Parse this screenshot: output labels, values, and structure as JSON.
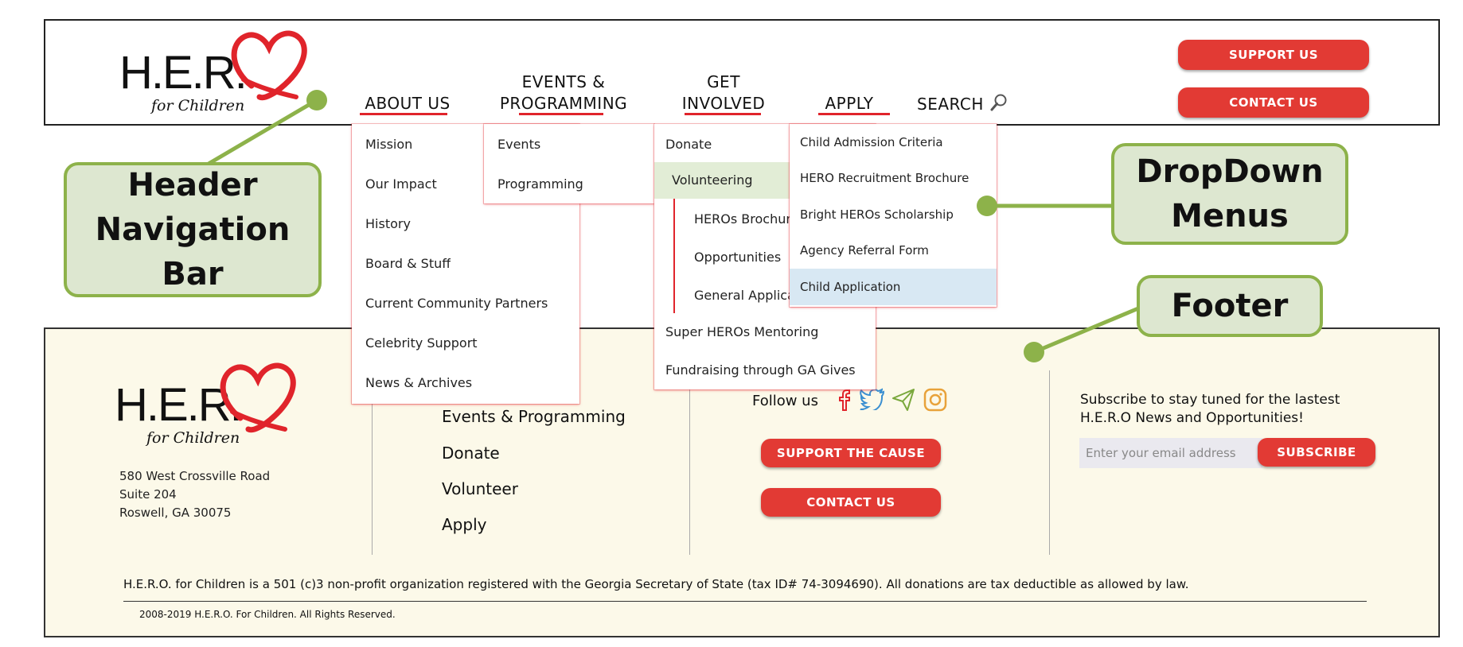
{
  "header": {
    "logo": {
      "letters": "H.E.R.",
      "tagline": "for Children"
    },
    "nav": [
      {
        "line1": "",
        "line2": "ABOUT US"
      },
      {
        "line1": "EVENTS &",
        "line2": "PROGRAMMING"
      },
      {
        "line1": "GET",
        "line2": "INVOLVED"
      },
      {
        "line1": "",
        "line2": "APPLY"
      }
    ],
    "search_label": "SEARCH",
    "support_button": "SUPPORT US",
    "contact_button": "CONTACT US"
  },
  "dropdowns": {
    "about": [
      "Mission",
      "Our Impact",
      "History",
      "Board & Stuff",
      "Current Community Partners",
      "Celebrity Support",
      "News & Archives"
    ],
    "events": [
      "Events",
      "Programming"
    ],
    "involved": {
      "donate": "Donate",
      "volunteering": "Volunteering",
      "volunteering_sub": [
        "HEROs Brochure",
        "Opportunities",
        "General Application"
      ],
      "mentoring": "Super HEROs Mentoring",
      "fundraising": "Fundraising through GA Gives"
    },
    "apply": [
      "Child Admission Criteria",
      "HERO Recruitment Brochure",
      "Bright HEROs Scholarship",
      "Agency Referral Form",
      "Child Application"
    ],
    "active_color": "#e2edd6",
    "highlight_color": "#d8e8f3"
  },
  "footer": {
    "logo": {
      "letters": "H.E.R.",
      "tagline": "for Children"
    },
    "address": [
      "580 West Crossville Road",
      "Suite 204",
      "Roswell, GA 30075"
    ],
    "links": [
      "Events & Programming",
      "Donate",
      "Volunteer",
      "Apply"
    ],
    "follow_label": "Follow us",
    "social_icons": [
      "facebook-icon",
      "twitter-icon",
      "send-icon",
      "instagram-icon"
    ],
    "support_cause_button": "SUPPORT THE CAUSE",
    "contact_button": "CONTACT US",
    "subscribe_text": "Subscribe to stay tuned for the lastest H.E.R.O News and Opportunities!",
    "email_placeholder": "Enter your email address",
    "subscribe_button": "SUBSCRIBE",
    "disclaimer": "H.E.R.O. for Children is a 501 (c)3 non-profit organization registered with the Georgia Secretary of State (tax ID# 74-3094690). All donations are tax deductible as allowed by law.",
    "copyright": "2008-2019 H.E.R.O. For Children. All Rights Reserved."
  },
  "annotations": {
    "header_nav": "Header Navigation Bar",
    "dropdown_menus": "DropDown Menus",
    "footer": "Footer"
  },
  "colors": {
    "brand_red": "#e23a34",
    "callout_green": "#8db24a",
    "callout_fill": "#dde7d0",
    "footer_bg": "#fcf9e9"
  }
}
